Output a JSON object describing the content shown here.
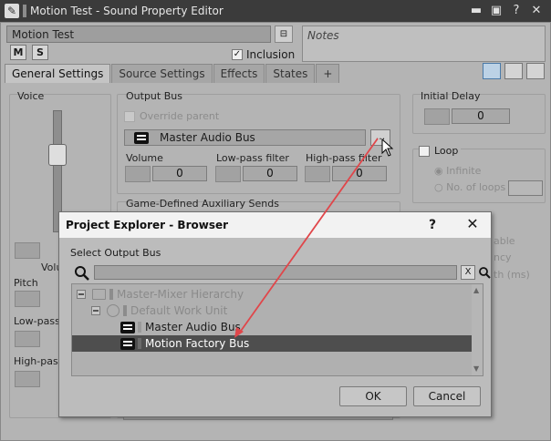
{
  "window": {
    "title": "Motion Test - Sound Property Editor"
  },
  "header": {
    "name": "Motion Test",
    "mute_label": "M",
    "solo_label": "S",
    "inclusion_label": "Inclusion",
    "inclusion_checked": "✓",
    "notes_placeholder": "Notes"
  },
  "tabs": [
    {
      "label": "General Settings"
    },
    {
      "label": "Source Settings"
    },
    {
      "label": "Effects"
    },
    {
      "label": "States"
    },
    {
      "label": "+"
    }
  ],
  "voice": {
    "label": "Voice",
    "volume_label": "Volu",
    "pitch_label": "Pitch",
    "lowpass_label": "Low-pass",
    "highpass_label": "High-pass"
  },
  "output_bus": {
    "label": "Output Bus",
    "override_label": "Override parent",
    "bus_name": "Master Audio Bus",
    "browse_label": "...",
    "volume_label": "Volume",
    "volume_value": "0",
    "lowpass_label": "Low-pass filter",
    "lowpass_value": "0",
    "highpass_label": "High-pass filter",
    "highpass_value": "0",
    "aux_label": "Game-Defined Auxiliary Sends"
  },
  "initial_delay": {
    "label": "Initial Delay",
    "value": "0"
  },
  "loop": {
    "label": "Loop",
    "infinite_label": "Infinite",
    "no_loops_label": "No. of loops"
  },
  "right_partial": {
    "line1": "able",
    "line2": "ncy",
    "line3": "th (ms)"
  },
  "dialog": {
    "title": "Project Explorer - Browser",
    "help_label": "?",
    "close_label": "✕",
    "select_label": "Select Output Bus",
    "search_value": "",
    "clear_label": "X",
    "tree": [
      {
        "label": "Master-Mixer Hierarchy"
      },
      {
        "label": "Default Work Unit"
      },
      {
        "label": "Master Audio Bus"
      },
      {
        "label": "Motion Factory Bus"
      }
    ],
    "ok_label": "OK",
    "cancel_label": "Cancel"
  },
  "colors": {
    "selection": "#4e4e4e",
    "annotation_arrow": "#e0464a",
    "titlebar": "#3b3b3b"
  }
}
